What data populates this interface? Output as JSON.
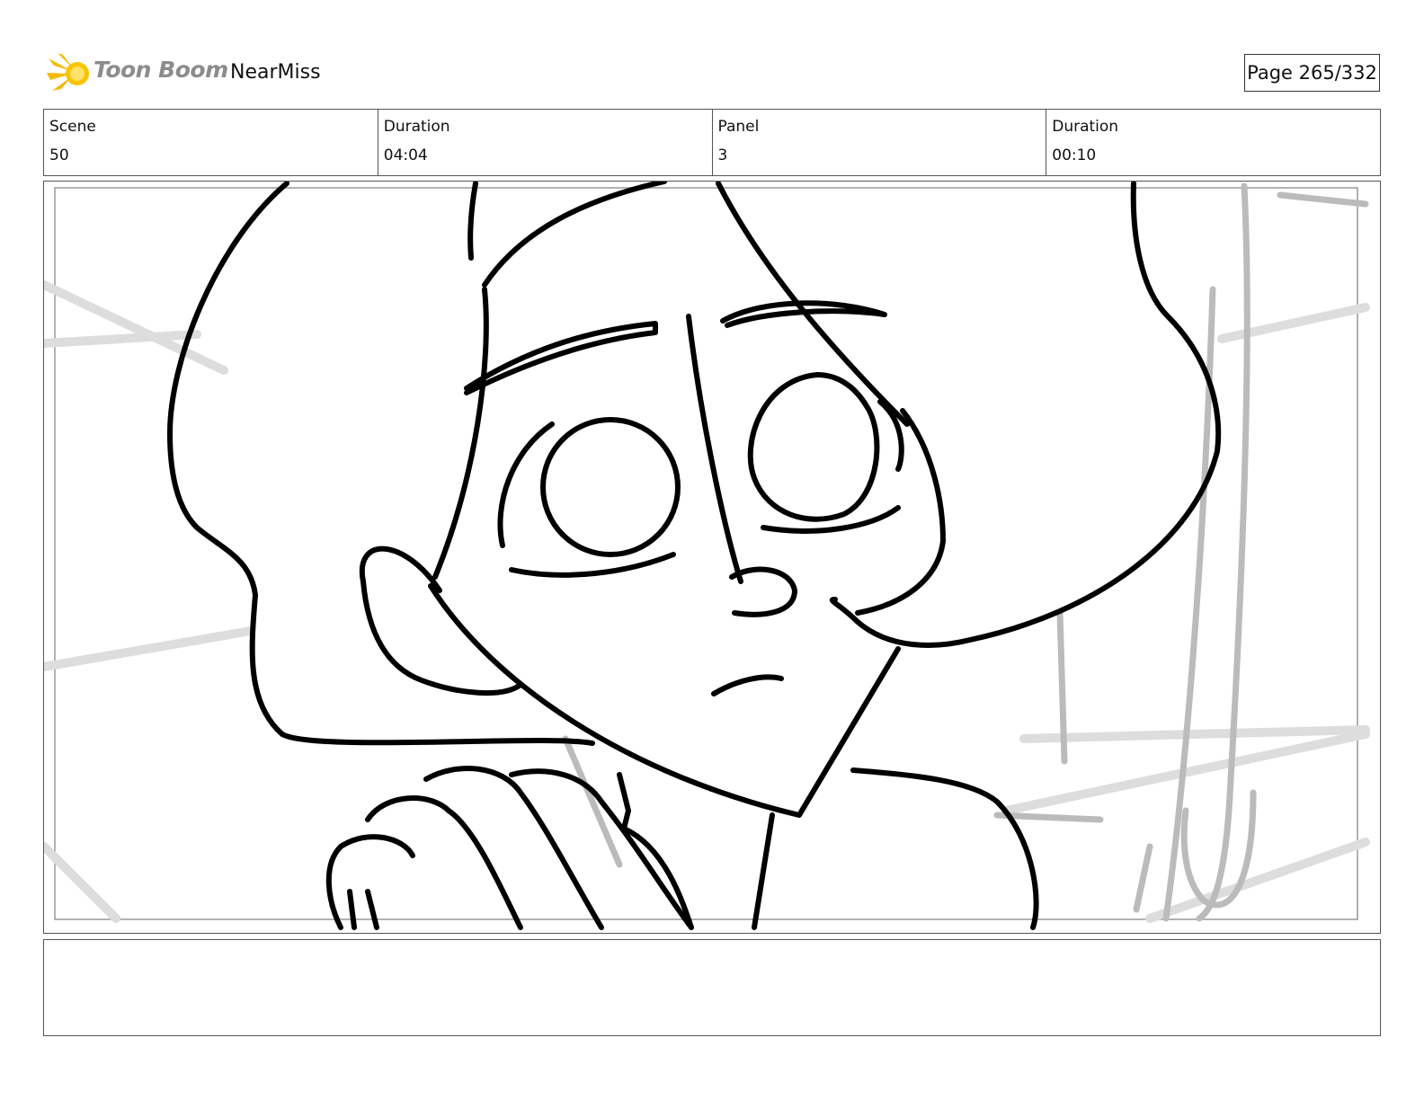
{
  "header": {
    "brand": "Toon Boom",
    "project": "NearMiss",
    "page": "Page 265/332"
  },
  "info": [
    {
      "label": "Scene",
      "value": "50"
    },
    {
      "label": "Duration",
      "value": "04:04"
    },
    {
      "label": "Panel",
      "value": "3"
    },
    {
      "label": "Duration",
      "value": "00:10"
    }
  ],
  "panel": {
    "image": "storyboard-sketch-character-closeup"
  },
  "caption": {
    "text": ""
  }
}
